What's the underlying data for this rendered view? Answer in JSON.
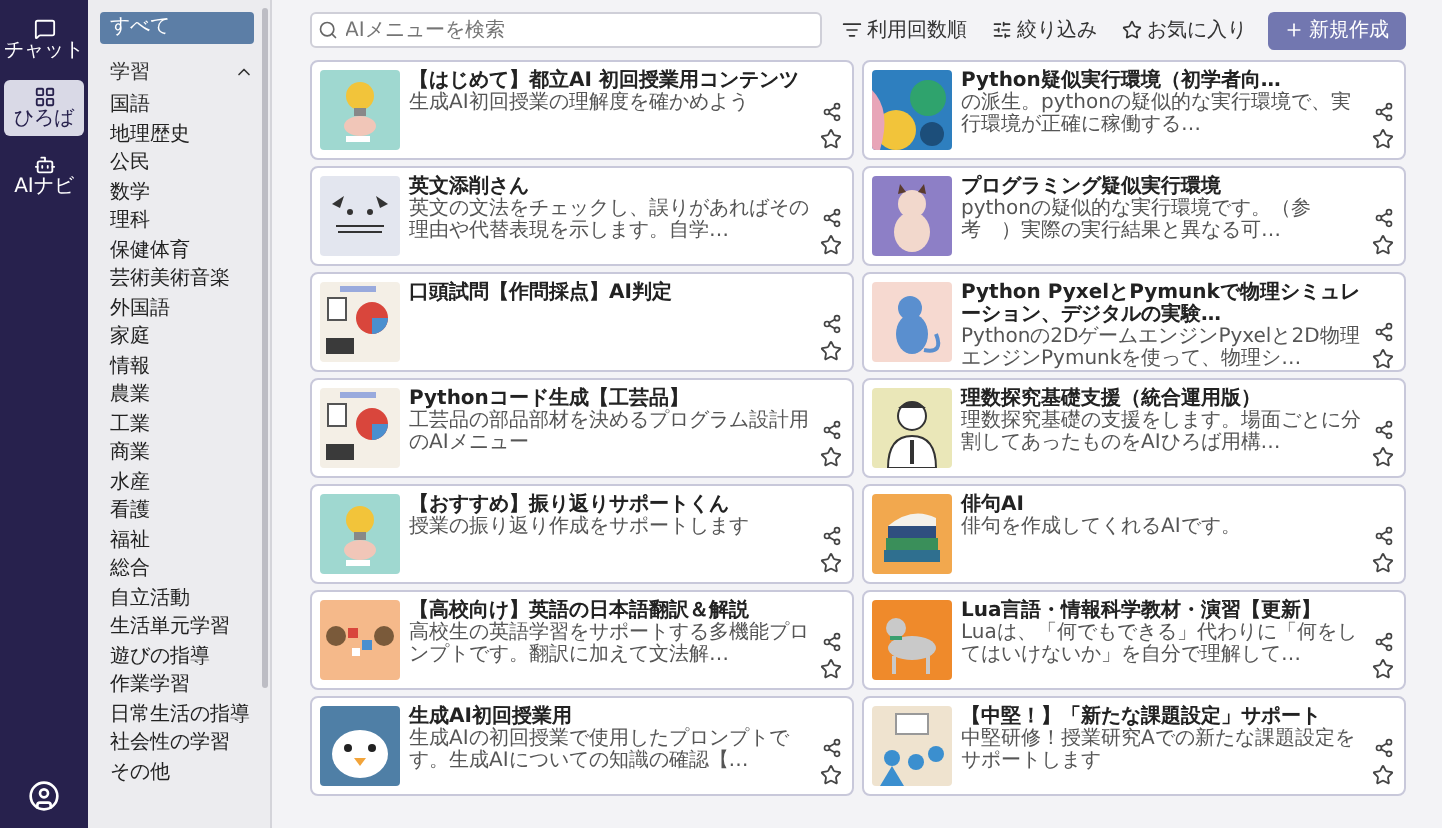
{
  "rail": {
    "items": [
      {
        "label": "チャット",
        "kind": "chat",
        "selected": false
      },
      {
        "label": "ひろば",
        "kind": "plaza",
        "selected": true
      },
      {
        "label": "AIナビ",
        "kind": "navi",
        "selected": false
      }
    ]
  },
  "sidebar": {
    "all": {
      "label": "すべて",
      "selected": true
    },
    "group": {
      "label": "学習",
      "expanded": true,
      "items": [
        {
          "label": "国語",
          "selected": false
        },
        {
          "label": "地理歴史",
          "selected": false
        },
        {
          "label": "公民",
          "selected": false
        },
        {
          "label": "数学",
          "selected": false
        },
        {
          "label": "理科",
          "selected": false
        },
        {
          "label": "保健体育",
          "selected": false
        },
        {
          "label": "芸術美術音楽",
          "selected": false
        },
        {
          "label": "外国語",
          "selected": false
        },
        {
          "label": "家庭",
          "selected": false
        },
        {
          "label": "情報",
          "selected": false
        },
        {
          "label": "農業",
          "selected": false
        },
        {
          "label": "工業",
          "selected": false
        },
        {
          "label": "商業",
          "selected": false
        },
        {
          "label": "水産",
          "selected": false
        },
        {
          "label": "看護",
          "selected": false
        },
        {
          "label": "福祉",
          "selected": false
        },
        {
          "label": "総合",
          "selected": false
        },
        {
          "label": "自立活動",
          "selected": false
        },
        {
          "label": "生活単元学習",
          "selected": false
        },
        {
          "label": "遊びの指導",
          "selected": false
        },
        {
          "label": "作業学習",
          "selected": false
        },
        {
          "label": "日常生活の指導",
          "selected": false
        },
        {
          "label": "社会性の学習",
          "selected": false
        },
        {
          "label": "その他",
          "selected": false
        }
      ]
    }
  },
  "toolbar": {
    "search": {
      "placeholder": "AIメニューを検索"
    },
    "buttons": [
      {
        "label": "利用回数順",
        "kind": "sort"
      },
      {
        "label": "絞り込み",
        "kind": "filter"
      },
      {
        "label": "お気に入り",
        "kind": "favorites"
      },
      {
        "label": "新規作成",
        "kind": "create"
      }
    ]
  },
  "cards": [
    {
      "title": "【はじめて】都立AI 初回授業用コンテンツ",
      "description": "生成AI初回授業の理解度を確かめよう",
      "favorite": false
    },
    {
      "title": "Python疑似実行環境（初学者向…",
      "description": "の派生。pythonの疑似的な実行環境で、実行環境が正確に稼働する…",
      "favorite": false
    },
    {
      "title": "英文添削さん",
      "description": "英文の文法をチェックし、誤りがあればその理由や代替表現を示します。自学…",
      "favorite": false
    },
    {
      "title": "プログラミング疑似実行環境",
      "description": "pythonの疑似的な実行環境です。（参考　）実際の実行結果と異なる可…",
      "favorite": false
    },
    {
      "title": "口頭試問【作問採点】AI判定",
      "favorite": false
    },
    {
      "title": "Python PyxelとPymunkで物理シミュレーション、デジタルの実験…",
      "description": "Pythonの2DゲームエンジンPyxelと2D物理エンジンPymunkを使って、物理シ…",
      "favorite": false
    },
    {
      "title": "Pythonコード生成【工芸品】",
      "description": "工芸品の部品部材を決めるプログラム設計用のAIメニュー",
      "favorite": false
    },
    {
      "title": "理数探究基礎支援（統合運用版）",
      "description": "理数探究基礎の支援をします。場面ごとに分割してあったものをAIひろば用構…",
      "favorite": false
    },
    {
      "title": "【おすすめ】振り返りサポートくん",
      "description": "授業の振り返り作成をサポートします",
      "favorite": false
    },
    {
      "title": "俳句AI",
      "description": "俳句を作成してくれるAIです。",
      "favorite": false
    },
    {
      "title": "【高校向け】英語の日本語翻訳＆解説",
      "description": "高校生の英語学習をサポートする多機能プロンプトです。翻訳に加えて文法解…",
      "favorite": false
    },
    {
      "title": "Lua言語・情報科学教材・演習【更新】",
      "description": "Luaは、「何でもできる」代わりに「何をしてはいけないか」を自分で理解して…",
      "favorite": false
    },
    {
      "title": "生成AI初回授業用",
      "description": "生成AIの初回授業で使用したプロンプトです。生成AIについての知識の確認【…",
      "favorite": false
    },
    {
      "title": "【中堅！】「新たな課題設定」サポート",
      "description": "中堅研修！授業研究Aでの新たな課題設定をサポートします",
      "favorite": false
    }
  ]
}
